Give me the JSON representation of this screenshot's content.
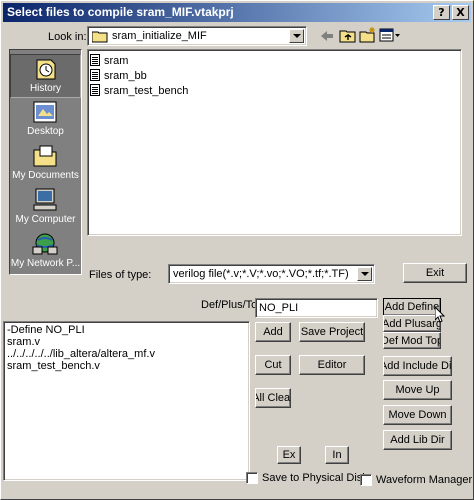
{
  "titlebar": {
    "title": "Select files to compile sram_MIF.vtakprj",
    "help_glyph": "?",
    "close_glyph": "X"
  },
  "lookin": {
    "label": "Look in:",
    "value": "sram_initialize_MIF"
  },
  "toolbar": {
    "icons": [
      "back-icon",
      "up-folder-icon",
      "new-folder-icon",
      "view-menu-icon"
    ]
  },
  "places": [
    {
      "label": "History",
      "icon": "history-icon"
    },
    {
      "label": "Desktop",
      "icon": "desktop-icon"
    },
    {
      "label": "My Documents",
      "icon": "my-documents-icon"
    },
    {
      "label": "My Computer",
      "icon": "my-computer-icon"
    },
    {
      "label": "My Network P...",
      "icon": "my-network-icon"
    }
  ],
  "files": [
    "sram",
    "sram_bb",
    "sram_test_bench"
  ],
  "filetype": {
    "label": "Files of type:",
    "value": "verilog file(*.v;*.V;*.vo;*.VO;*.tf;*.TF)"
  },
  "buttons": {
    "exit": "Exit",
    "add_define": "Add Define",
    "add_plusarg": "Add Plusarg",
    "def_mod_top": "Def Mod Top",
    "add": "Add",
    "save_project": "Save Project",
    "cut": "Cut",
    "editor": "Editor",
    "all_clear": "All Clear",
    "add_include_dir": "Add Include Dir",
    "move_up": "Move Up",
    "move_down": "Move Down",
    "add_lib_dir": "Add Lib Dir",
    "ex": "Ex",
    "in": "In"
  },
  "defplus": {
    "label": "Def/Plus/Top",
    "value": "NO_PLI"
  },
  "project_list": [
    "-Define NO_PLI",
    "sram.v",
    "../../../../../lib_altera/altera_mf.v",
    "sram_test_bench.v"
  ],
  "options": {
    "save_physical": "Save to Physical Disk",
    "waveform_manager": "Waveform Manager"
  },
  "colors": {
    "titlebar_start": "#0a246a",
    "titlebar_end": "#a6caf0",
    "face": "#d4d0c8"
  }
}
